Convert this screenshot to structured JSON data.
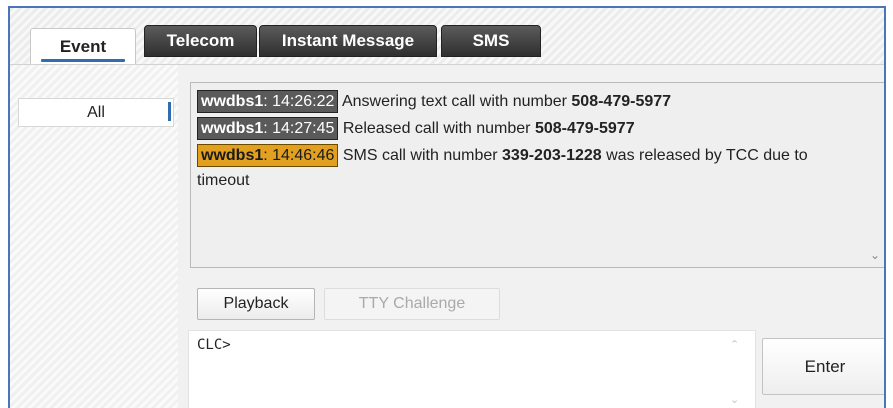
{
  "tabs": [
    {
      "label": "Event",
      "active": true
    },
    {
      "label": "Telecom",
      "active": false
    },
    {
      "label": "Instant Message",
      "active": false
    },
    {
      "label": "SMS",
      "active": false
    }
  ],
  "sidebar": {
    "items": [
      {
        "label": "All",
        "selected": true
      }
    ]
  },
  "log": {
    "entries": [
      {
        "source": "wwdbs1",
        "time": "14:26:22",
        "text": "Answering text call with number ",
        "number": "508-479-5977",
        "suffix": "",
        "highlight": "gray"
      },
      {
        "source": "wwdbs1",
        "time": "14:27:45",
        "text": "Released call with number ",
        "number": "508-479-5977",
        "suffix": "",
        "highlight": "gray"
      },
      {
        "source": "wwdbs1",
        "time": "14:46:46",
        "text": "SMS call with number ",
        "number": "339-203-1228",
        "suffix": " was released by TCC due to timeout",
        "highlight": "orange"
      }
    ]
  },
  "buttons": {
    "playback": "Playback",
    "tty": "TTY Challenge",
    "enter": "Enter"
  },
  "command": {
    "value": "CLC>"
  },
  "colors": {
    "accent": "#2f6db0",
    "frame": "#4a76b8",
    "gray_badge": "#5a5a5a",
    "orange_badge": "#e2a020"
  }
}
